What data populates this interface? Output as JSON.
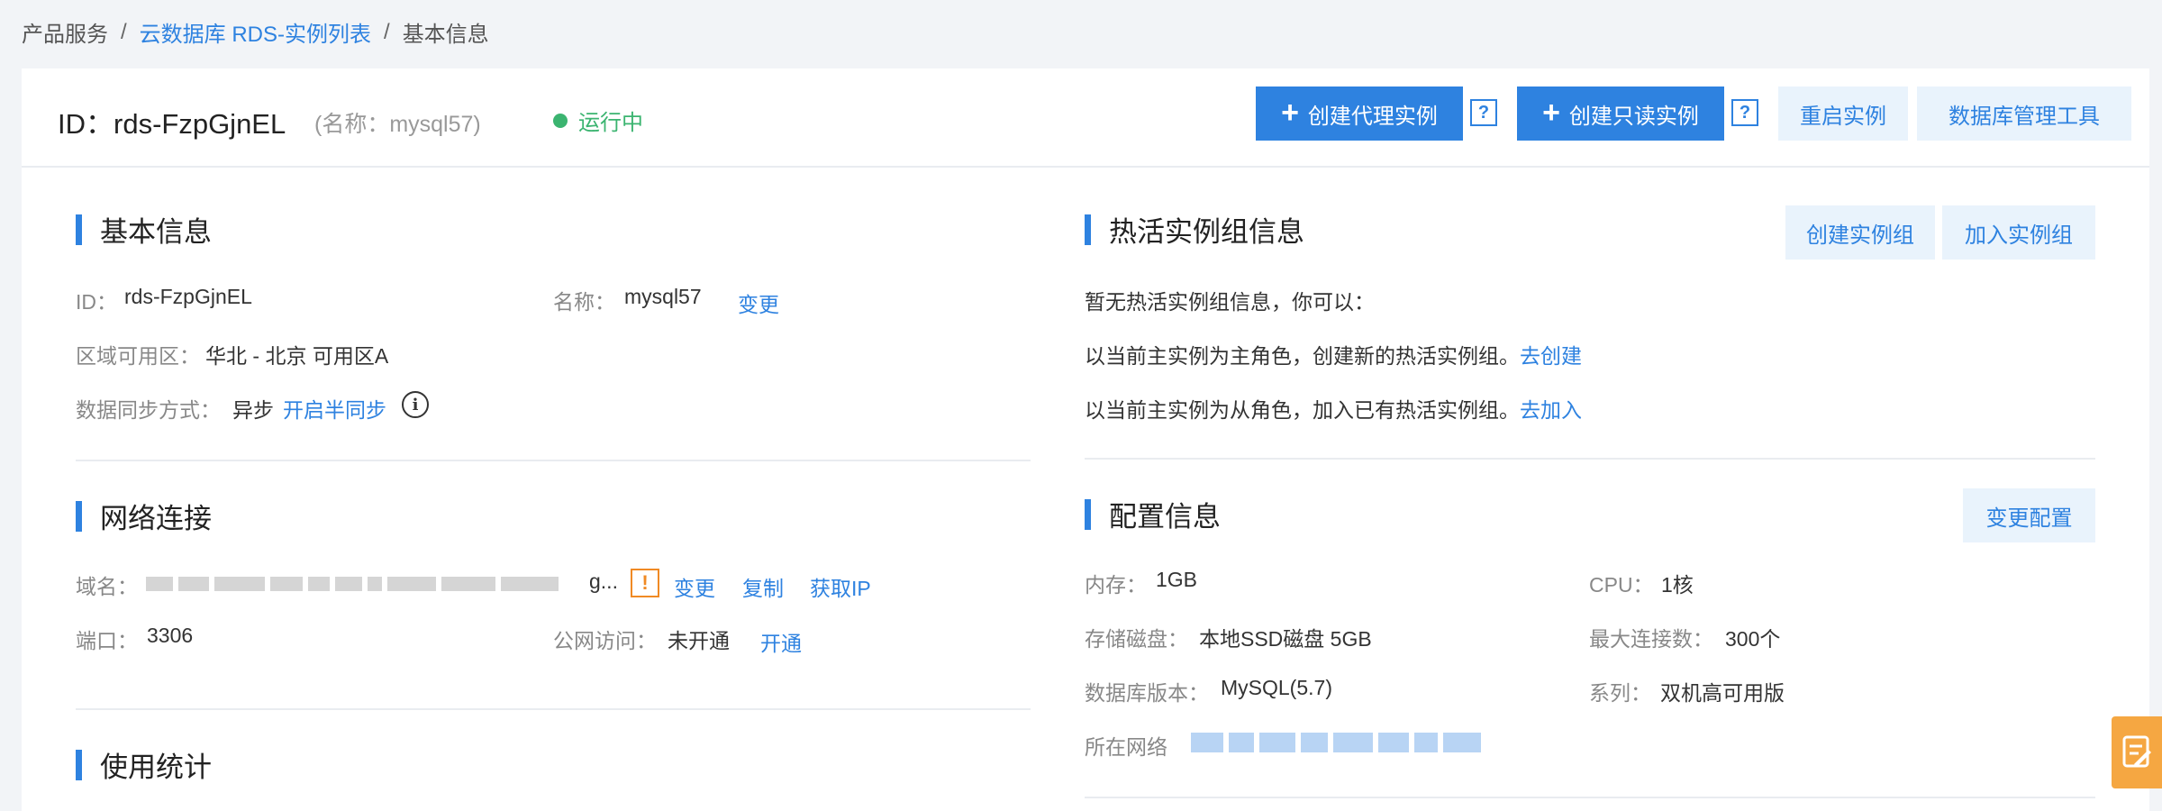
{
  "breadcrumb": {
    "item1": "产品服务",
    "sep": "/",
    "item2": "云数据库 RDS-实例列表",
    "item3": "基本信息"
  },
  "header": {
    "instance_id": "ID：rds-FzpGjnEL",
    "instance_name": "(名称：mysql57)",
    "status": "运行中",
    "btn_create_proxy": "创建代理实例",
    "btn_create_readonly": "创建只读实例",
    "help": "?",
    "btn_restart": "重启实例",
    "btn_db_tool": "数据库管理工具"
  },
  "basic_info": {
    "title": "基本信息",
    "id_label": "ID：",
    "id_value": "rds-FzpGjnEL",
    "name_label": "名称：",
    "name_value": "mysql57",
    "name_change": "变更",
    "zone_label": "区域可用区：",
    "zone_value": "华北 - 北京 可用区A",
    "sync_label": "数据同步方式：",
    "sync_value": "异步",
    "sync_action": "开启半同步",
    "info_symbol": "i"
  },
  "network": {
    "title": "网络连接",
    "domain_label": "域名：",
    "domain_tail": "g...",
    "warn_symbol": "!",
    "change": "变更",
    "copy": "复制",
    "get_ip": "获取IP",
    "port_label": "端口：",
    "port_value": "3306",
    "public_label": "公网访问：",
    "public_value": "未开通",
    "public_action": "开通"
  },
  "usage": {
    "title": "使用统计"
  },
  "hot_group": {
    "title": "热活实例组信息",
    "btn_create": "创建实例组",
    "btn_join": "加入实例组",
    "empty_text": "暂无热活实例组信息，你可以：",
    "line1": "以当前主实例为主角色，创建新的热活实例组。",
    "line1_link": "去创建",
    "line2": "以当前主实例为从角色，加入已有热活实例组。",
    "line2_link": "去加入"
  },
  "config": {
    "title": "配置信息",
    "btn_change": "变更配置",
    "memory_label": "内存：",
    "memory_value": "1GB",
    "cpu_label": "CPU：",
    "cpu_value": "1核",
    "disk_label": "存储磁盘：",
    "disk_value": "本地SSD磁盘 5GB",
    "maxconn_label": "最大连接数：",
    "maxconn_value": "300个",
    "version_label": "数据库版本：",
    "version_value": "MySQL(5.7)",
    "series_label": "系列：",
    "series_value": "双机高可用版",
    "network_label": "所在网络"
  },
  "icons": {
    "plus": "plus-icon",
    "help": "question-icon",
    "info": "info-circle-icon",
    "warn": "warning-icon",
    "feedback": "feedback-icon"
  },
  "colors": {
    "accent": "#2e82e0",
    "success": "#3bb470",
    "warning": "#f08a24",
    "float_tab": "#f5a742"
  }
}
